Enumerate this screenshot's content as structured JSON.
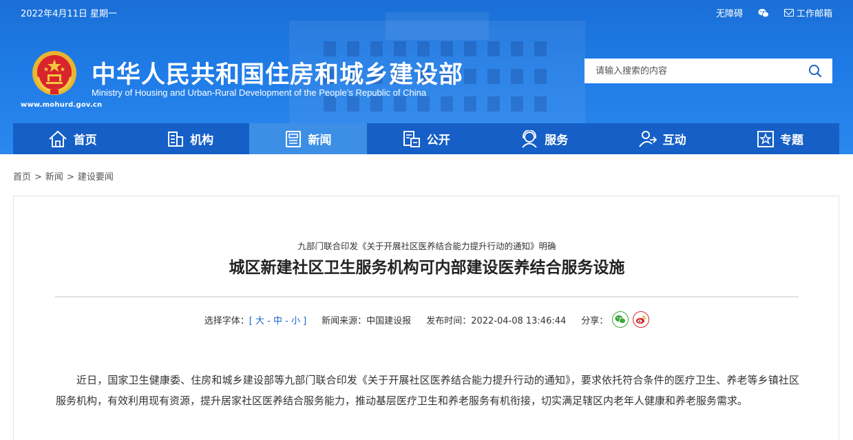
{
  "topbar": {
    "date": "2022年4月11日 星期一",
    "accessibility": "无障碍",
    "wechat_icon": "wechat-icon",
    "mail_label": "工作邮箱"
  },
  "header": {
    "url": "www.mohurd.gov.cn",
    "title": "中华人民共和国住房和城乡建设部",
    "subtitle": "Ministry of Housing and Urban-Rural Development of the People’s Republic of China",
    "search_placeholder": "请输入搜索的内容"
  },
  "nav": {
    "items": [
      {
        "label": "首页",
        "icon": "home-icon"
      },
      {
        "label": "机构",
        "icon": "building-icon"
      },
      {
        "label": "新闻",
        "icon": "news-icon"
      },
      {
        "label": "公开",
        "icon": "public-icon"
      },
      {
        "label": "服务",
        "icon": "service-icon"
      },
      {
        "label": "互动",
        "icon": "interact-icon"
      },
      {
        "label": "专题",
        "icon": "topic-icon"
      }
    ],
    "active_index": 2
  },
  "breadcrumb": {
    "items": [
      "首页",
      "新闻",
      "建设要闻"
    ],
    "separator": ">"
  },
  "article": {
    "pre_title": "九部门联合印发《关于开展社区医养结合能力提升行动的通知》明确",
    "title": "城区新建社区卫生服务机构可内部建设医养结合服务设施",
    "meta": {
      "font_label": "选择字体：",
      "bracket_open": "[",
      "font_large": "大",
      "dash1": "-",
      "font_medium": "中",
      "dash2": "-",
      "font_small": "小",
      "bracket_close": "]",
      "source": "新闻来源：中国建设报",
      "time": "发布时间：2022-04-08 13:46:44",
      "share_label": "分享："
    },
    "body": "近日，国家卫生健康委、住房和城乡建设部等九部门联合印发《关于开展社区医养结合能力提升行动的通知》，要求依托符合条件的医疗卫生、养老等乡镇社区服务机构，有效利用现有资源，提升居家社区医养结合服务能力，推动基层医疗卫生和养老服务有机衔接，切实满足辖区内老年人健康和养老服务需求。"
  },
  "colors": {
    "header_blue": "#1f7be6",
    "nav_blue": "#155fc7",
    "nav_active": "#3d8fe6",
    "link_blue": "#1a64c8",
    "wechat_green": "#3aa83a",
    "weibo_red": "#d8252b"
  }
}
